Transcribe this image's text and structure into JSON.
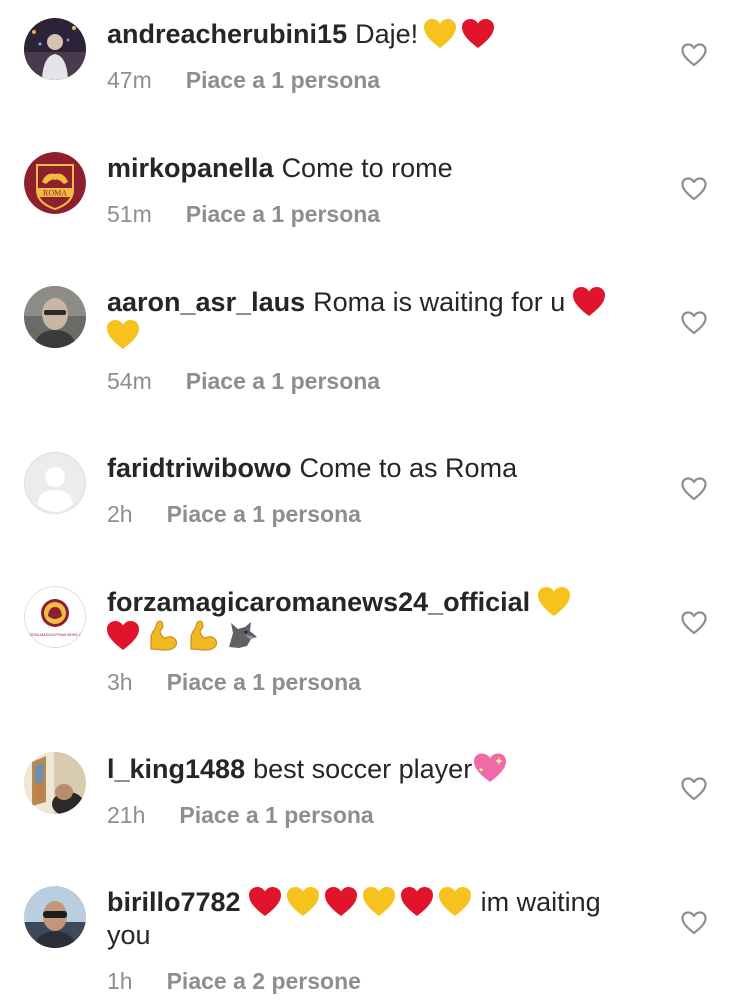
{
  "comments": [
    {
      "username": "andreacherubini15",
      "text": "Daje!",
      "emojis": [
        "yellow-heart",
        "red-heart"
      ],
      "time": "47m",
      "likes": "Piace a 1 persona",
      "avatar": "user-photo-night-city"
    },
    {
      "username": "mirkopanella",
      "text": "Come to rome",
      "emojis": [],
      "time": "51m",
      "likes": "Piace a 1 persona",
      "avatar": "as-roma-crest",
      "avatar_text": "ROMA"
    },
    {
      "username": "aaron_asr_laus",
      "text": "Roma is waiting for u",
      "emojis": [
        "red-heart",
        "yellow-heart"
      ],
      "time": "54m",
      "likes": "Piace a 1 persona",
      "avatar": "user-photo-bald-man"
    },
    {
      "username": "faridtriwibowo",
      "text": "Come to as Roma",
      "emojis": [],
      "time": "2h",
      "likes": "Piace a 1 persona",
      "avatar": "default-user"
    },
    {
      "username": "forzamagicaromanews24_official",
      "text": "",
      "emojis": [
        "yellow-heart",
        "red-heart",
        "flexed-biceps",
        "flexed-biceps",
        "wolf"
      ],
      "time": "3h",
      "likes": "Piace a 1 persona",
      "avatar": "forza-magica-roma-logo",
      "avatar_text": "FORZA MAGICA ROMA NEWS 24"
    },
    {
      "username": "l_king1488",
      "text": "best soccer player",
      "emojis": [
        "sparkling-heart"
      ],
      "time": "21h",
      "likes": "Piace a 1 persona",
      "avatar": "user-photo-church"
    },
    {
      "username": "birillo7782",
      "text_before": "",
      "emojis": [
        "red-heart",
        "yellow-heart",
        "red-heart",
        "yellow-heart",
        "red-heart",
        "yellow-heart"
      ],
      "text": "im waiting you",
      "time": "1h",
      "likes": "Piace a 2 persone",
      "avatar": "user-photo-sunglasses"
    }
  ],
  "colors": {
    "text": "#262626",
    "secondary": "#8e8e8e",
    "red_heart": "#e0152b",
    "yellow_heart": "#f7c21e",
    "roma_crimson": "#8e1f2f",
    "roma_gold": "#f0bc42"
  },
  "icons": {
    "like": "heart-outline-icon"
  }
}
